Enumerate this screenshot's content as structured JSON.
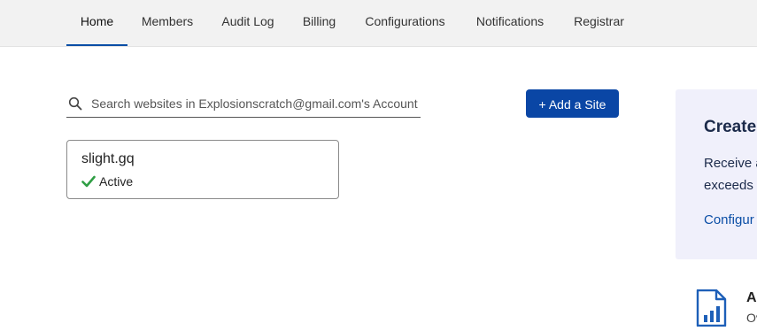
{
  "nav": {
    "tabs": [
      {
        "label": "Home",
        "active": true
      },
      {
        "label": "Members",
        "active": false
      },
      {
        "label": "Audit Log",
        "active": false
      },
      {
        "label": "Billing",
        "active": false
      },
      {
        "label": "Configurations",
        "active": false
      },
      {
        "label": "Notifications",
        "active": false
      },
      {
        "label": "Registrar",
        "active": false
      }
    ]
  },
  "search": {
    "icon": "search-icon",
    "placeholder": "Search websites in Explosionscratch@gmail.com's Account",
    "value": ""
  },
  "add_site_button": {
    "label": "+ Add a Site",
    "color": "#0a46a5"
  },
  "sites": [
    {
      "name": "slight.gq",
      "status": "Active",
      "status_icon": "check-icon",
      "status_color": "#2f9e44"
    }
  ],
  "promo": {
    "title": "Create",
    "lines": [
      "Receive a",
      "exceeds"
    ],
    "link": "Configur",
    "background": "#f0f0fb"
  },
  "side_section": {
    "icon": "analytics-report-icon",
    "heading": "Ac",
    "sub": "Ov"
  },
  "colors": {
    "accent": "#0a4ea6",
    "nav_bg": "#f2f2f2"
  }
}
